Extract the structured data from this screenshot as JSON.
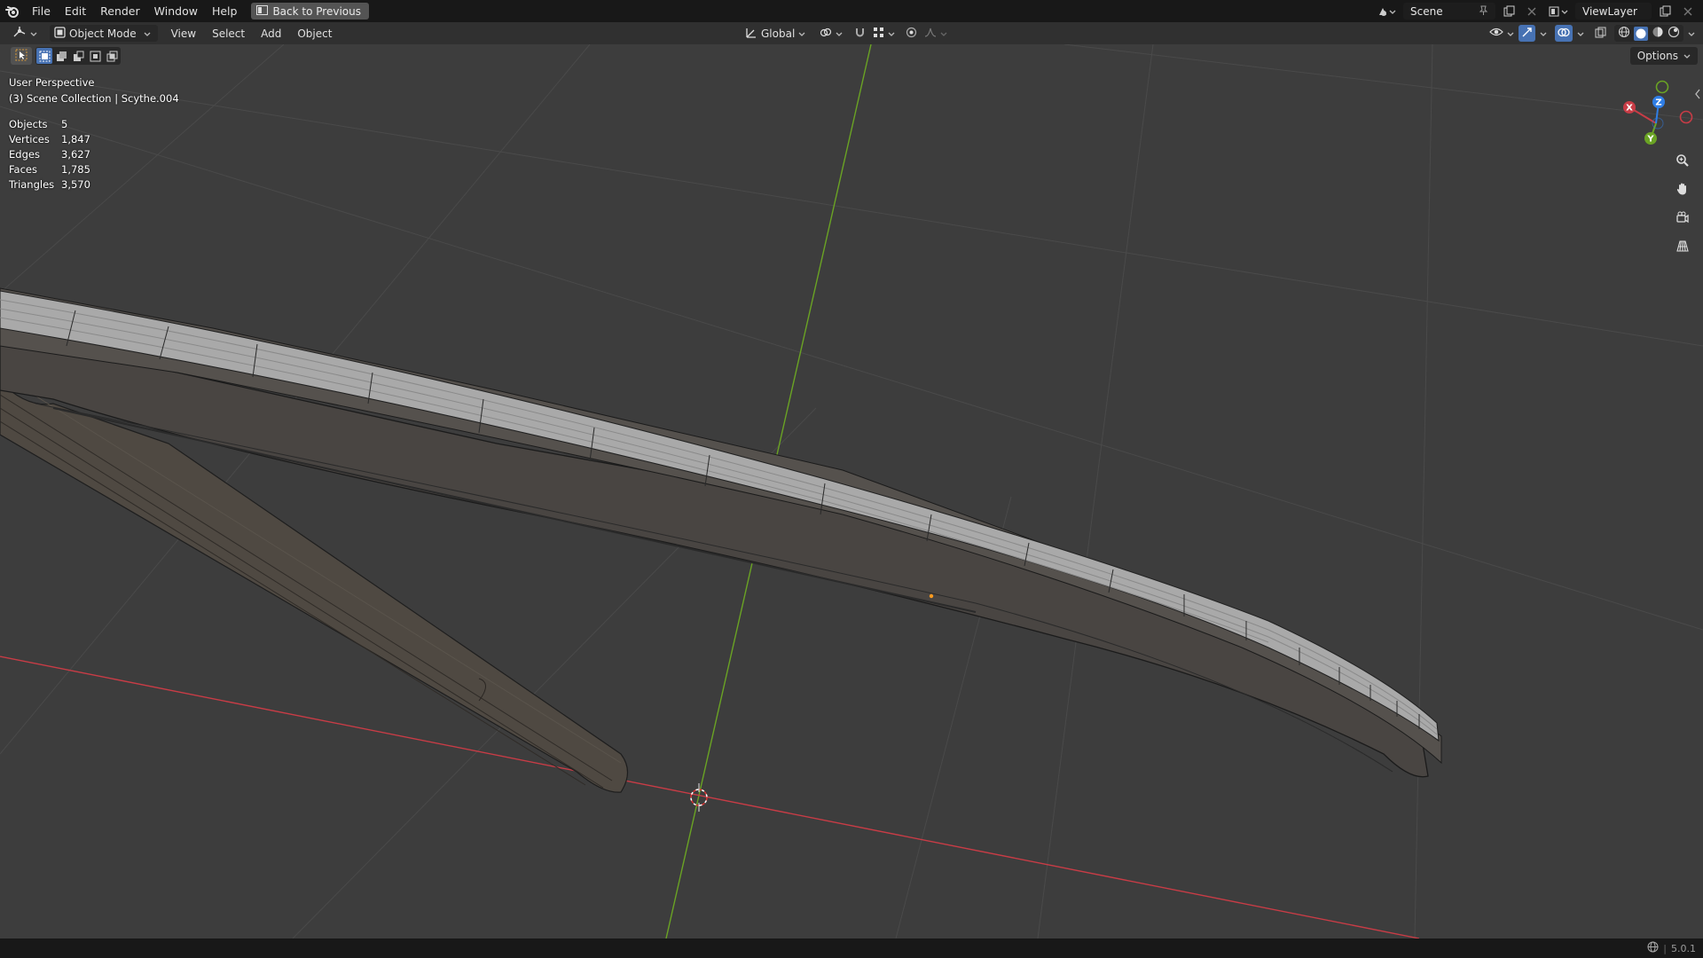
{
  "menubar": {
    "items": [
      "File",
      "Edit",
      "Render",
      "Window",
      "Help"
    ],
    "back_label": "Back to Previous",
    "scene_label": "Scene",
    "viewlayer_label": "ViewLayer"
  },
  "header": {
    "mode_label": "Object Mode",
    "menus": [
      "View",
      "Select",
      "Add",
      "Object"
    ],
    "orientation_label": "Global",
    "options_label": "Options"
  },
  "overlay": {
    "perspective": "User Perspective",
    "collection": "(3) Scene Collection | Scythe.004"
  },
  "stats": [
    {
      "key": "Objects",
      "value": "5"
    },
    {
      "key": "Vertices",
      "value": "1,847"
    },
    {
      "key": "Edges",
      "value": "3,627"
    },
    {
      "key": "Faces",
      "value": "1,785"
    },
    {
      "key": "Triangles",
      "value": "3,570"
    }
  ],
  "gizmo": {
    "x": "X",
    "y": "Y",
    "z": "Z"
  },
  "statusbar": {
    "version": "5.0.1"
  },
  "colors": {
    "accent": "#4772b3",
    "x_axis": "#d13b4b",
    "y_axis": "#6aa324",
    "z_axis": "#2f7ee6",
    "background": "#3d3d3d"
  }
}
